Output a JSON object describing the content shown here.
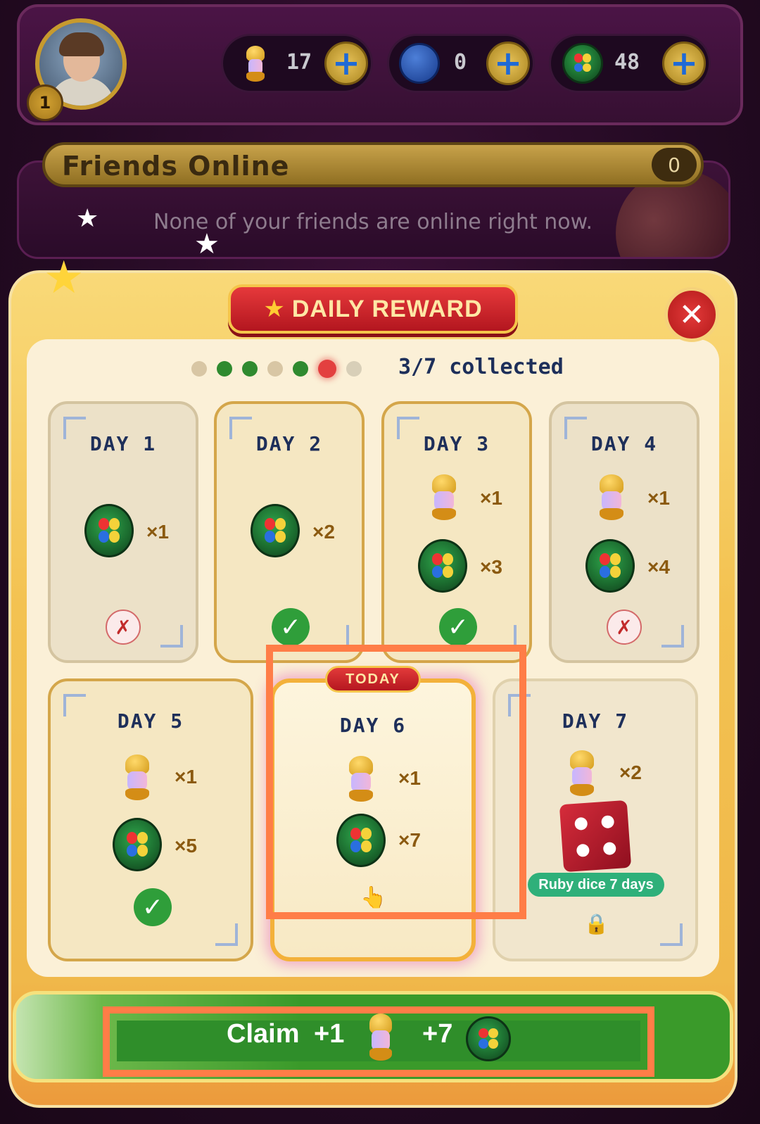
{
  "header": {
    "level": "1",
    "currencies": [
      {
        "name": "lantern",
        "value": "17"
      },
      {
        "name": "steem",
        "value": "0"
      },
      {
        "name": "coin",
        "value": "48"
      }
    ],
    "plus_symbol": "+"
  },
  "friends": {
    "title": "Friends Online",
    "count": "0",
    "message": "None of your friends are online right now."
  },
  "daily_reward": {
    "title": "DAILY REWARD",
    "close_symbol": "✕",
    "progress_text": "3/7 collected",
    "progress_dots": [
      "missed",
      "collected",
      "collected",
      "missed",
      "collected",
      "today",
      "upcoming"
    ],
    "today_tag": "TODAY",
    "days": [
      {
        "label": "DAY 1",
        "status": "missed",
        "rewards": [
          {
            "item": "coin",
            "qty": "×1"
          }
        ]
      },
      {
        "label": "DAY 2",
        "status": "collected",
        "rewards": [
          {
            "item": "coin",
            "qty": "×2"
          }
        ]
      },
      {
        "label": "DAY 3",
        "status": "collected",
        "rewards": [
          {
            "item": "lantern",
            "qty": "×1"
          },
          {
            "item": "coin",
            "qty": "×3"
          }
        ]
      },
      {
        "label": "DAY 4",
        "status": "missed",
        "rewards": [
          {
            "item": "lantern",
            "qty": "×1"
          },
          {
            "item": "coin",
            "qty": "×4"
          }
        ]
      },
      {
        "label": "DAY 5",
        "status": "collected",
        "rewards": [
          {
            "item": "lantern",
            "qty": "×1"
          },
          {
            "item": "coin",
            "qty": "×5"
          }
        ]
      },
      {
        "label": "DAY 6",
        "status": "today",
        "rewards": [
          {
            "item": "lantern",
            "qty": "×1"
          },
          {
            "item": "coin",
            "qty": "×7"
          }
        ]
      },
      {
        "label": "DAY 7",
        "status": "locked",
        "rewards": [
          {
            "item": "lantern",
            "qty": "×2"
          },
          {
            "item": "ruby-dice",
            "qty": "Ruby dice 7 days"
          }
        ]
      }
    ],
    "check_symbol": "✓",
    "cross_symbol": "✗",
    "lock_symbol": "🔒",
    "hand_symbol": "👆",
    "star_symbol": "★",
    "claim": {
      "label": "Claim",
      "lantern_amount": "+1",
      "coin_amount": "+7"
    }
  },
  "colors": {
    "dot_missed": "#d8c6a4",
    "dot_collected": "#2f8a2f",
    "dot_today": "#e3403f",
    "dot_upcoming": "#d8cfb8",
    "highlight": "#ff7d47"
  }
}
